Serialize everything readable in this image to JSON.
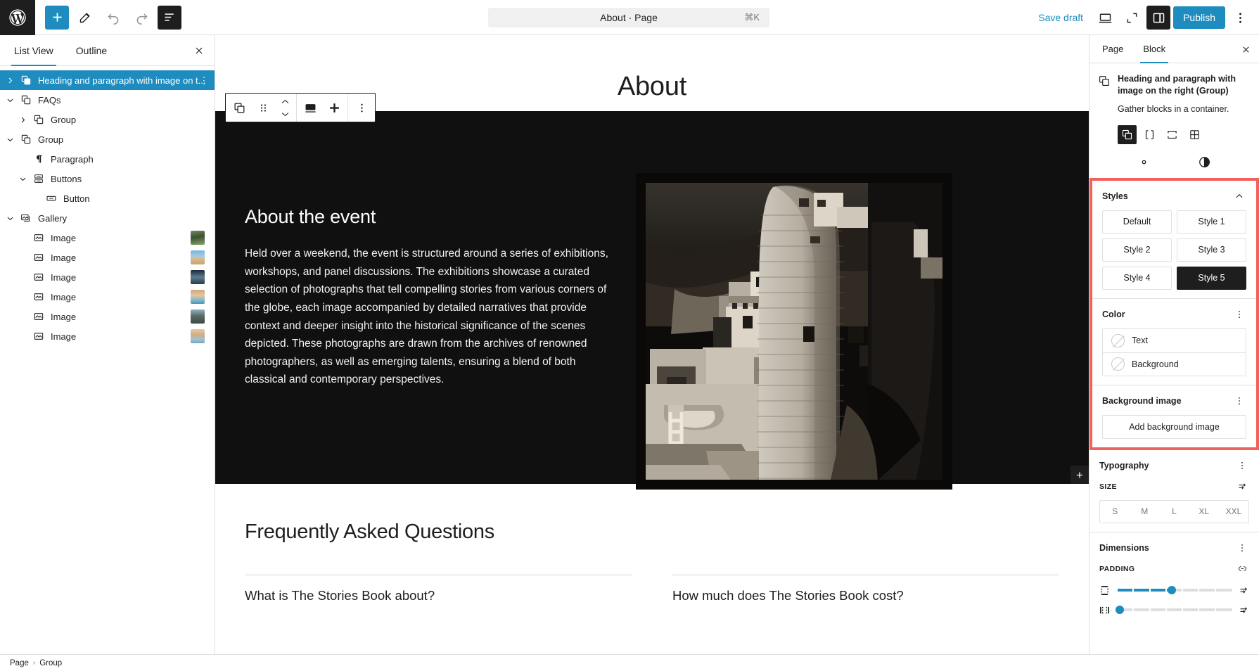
{
  "topbar": {
    "logo_icon": "wordpress-logo",
    "tools": [
      {
        "name": "add-block-button",
        "icon": "plus-icon"
      },
      {
        "name": "edit-tool-button",
        "icon": "pencil-icon"
      },
      {
        "name": "undo-button",
        "icon": "undo-arrow-icon"
      },
      {
        "name": "redo-button",
        "icon": "redo-arrow-icon"
      },
      {
        "name": "list-view-button",
        "icon": "list-view-icon"
      }
    ],
    "document_title": "About · Page",
    "command_shortcut": "⌘K",
    "save_draft_label": "Save draft",
    "preview_icon": "desktop-icon",
    "zoom_out_icon": "zoom-out-icon",
    "settings_panel_icon": "sidebar-toggle-icon",
    "publish_label": "Publish",
    "more_options_icon": "vertical-dots-icon",
    "accent_color": "#1e8cbe",
    "dark_color": "#1e1e1e"
  },
  "left_sidebar": {
    "tabs": [
      {
        "label": "List View",
        "active": true
      },
      {
        "label": "Outline",
        "active": false
      }
    ],
    "close_icon": "close-icon",
    "items": [
      {
        "label": "Heading and paragraph with image on t...",
        "icon": "group-block-icon",
        "indent": 0,
        "chevron": "right",
        "selected": true,
        "has_more": true,
        "thumb": ""
      },
      {
        "label": "FAQs",
        "icon": "group-block-icon",
        "indent": 0,
        "chevron": "down",
        "selected": false,
        "has_more": false,
        "thumb": ""
      },
      {
        "label": "Group",
        "icon": "group-block-icon",
        "indent": 1,
        "chevron": "right",
        "selected": false,
        "has_more": false,
        "thumb": ""
      },
      {
        "label": "Group",
        "icon": "group-block-icon",
        "indent": 0,
        "chevron": "down",
        "selected": false,
        "has_more": false,
        "thumb": ""
      },
      {
        "label": "Paragraph",
        "icon": "paragraph-icon",
        "indent": 1,
        "chevron": "none",
        "selected": false,
        "has_more": false,
        "thumb": ""
      },
      {
        "label": "Buttons",
        "icon": "buttons-icon",
        "indent": 1,
        "chevron": "down",
        "selected": false,
        "has_more": false,
        "thumb": ""
      },
      {
        "label": "Button",
        "icon": "button-icon",
        "indent": 2,
        "chevron": "none",
        "selected": false,
        "has_more": false,
        "thumb": ""
      },
      {
        "label": "Gallery",
        "icon": "gallery-icon",
        "indent": 0,
        "chevron": "down",
        "selected": false,
        "has_more": false,
        "thumb": ""
      },
      {
        "label": "Image",
        "icon": "image-icon",
        "indent": 1,
        "chevron": "none",
        "selected": false,
        "has_more": false,
        "thumb": "forest"
      },
      {
        "label": "Image",
        "icon": "image-icon",
        "indent": 1,
        "chevron": "none",
        "selected": false,
        "has_more": false,
        "thumb": "desert"
      },
      {
        "label": "Image",
        "icon": "image-icon",
        "indent": 1,
        "chevron": "none",
        "selected": false,
        "has_more": false,
        "thumb": "lake"
      },
      {
        "label": "Image",
        "icon": "image-icon",
        "indent": 1,
        "chevron": "none",
        "selected": false,
        "has_more": false,
        "thumb": "beach"
      },
      {
        "label": "Image",
        "icon": "image-icon",
        "indent": 1,
        "chevron": "none",
        "selected": false,
        "has_more": false,
        "thumb": "coast"
      },
      {
        "label": "Image",
        "icon": "image-icon",
        "indent": 1,
        "chevron": "none",
        "selected": false,
        "has_more": false,
        "thumb": "shore"
      }
    ]
  },
  "canvas": {
    "page_title": "About",
    "block_toolbar": {
      "block_type_icon": "group-block-icon",
      "drag_icon": "drag-handle-icon",
      "move_up_icon": "chevron-up-icon",
      "move_down_icon": "chevron-down-icon",
      "align_icon": "align-full-icon",
      "spacing_icon": "spacing-icon",
      "more_icon": "vertical-dots-icon"
    },
    "hero": {
      "heading": "About the event",
      "paragraph": "Held over a weekend, the event is structured around a series of exhibitions, workshops, and panel discussions. The exhibitions showcase a curated selection of photographs that tell compelling stories from various corners of the globe, each image accompanied by detailed narratives that provide context and deeper insight into the historical significance of the scenes depicted. These photographs are drawn from the archives of renowned photographers, as well as emerging talents, ensuring a blend of both classical and contemporary perspectives.",
      "background_color": "#101010",
      "text_color": "#ffffff",
      "appender_icon": "plus-icon",
      "image_alt": "Black and white photograph of ancient cliff dwelling ruins with a tall stone tower"
    },
    "faq": {
      "heading": "Frequently Asked Questions",
      "questions": [
        "What is The Stories Book about?",
        "How much does The Stories Book cost?"
      ]
    }
  },
  "right_sidebar": {
    "tabs": [
      {
        "label": "Page",
        "active": false
      },
      {
        "label": "Block",
        "active": true
      }
    ],
    "close_icon": "close-icon",
    "block_card": {
      "icon": "group-block-icon",
      "title": "Heading and paragraph with image on the right (Group)",
      "description": "Gather blocks in a container."
    },
    "variations": [
      {
        "name": "group-variation",
        "icon": "group-icon",
        "active": true
      },
      {
        "name": "row-variation",
        "icon": "row-icon",
        "active": false
      },
      {
        "name": "stack-variation",
        "icon": "stack-icon",
        "active": false
      },
      {
        "name": "grid-variation",
        "icon": "grid-icon",
        "active": false
      }
    ],
    "tab_icons": [
      {
        "name": "settings-tab",
        "icon": "gear-icon"
      },
      {
        "name": "styles-tab",
        "icon": "contrast-icon"
      }
    ],
    "styles_panel": {
      "title": "Styles",
      "collapse_icon": "chevron-up-icon",
      "options": [
        {
          "label": "Default",
          "active": false
        },
        {
          "label": "Style 1",
          "active": false
        },
        {
          "label": "Style 2",
          "active": false
        },
        {
          "label": "Style 3",
          "active": false
        },
        {
          "label": "Style 4",
          "active": false
        },
        {
          "label": "Style 5",
          "active": true
        }
      ]
    },
    "color_panel": {
      "title": "Color",
      "menu_icon": "vertical-dots-icon",
      "rows": [
        {
          "label": "Text",
          "swatch": "none"
        },
        {
          "label": "Background",
          "swatch": "none"
        }
      ]
    },
    "background_image_panel": {
      "title": "Background image",
      "menu_icon": "vertical-dots-icon",
      "button_label": "Add background image"
    },
    "typography_panel": {
      "title": "Typography",
      "menu_icon": "vertical-dots-icon",
      "size_label": "SIZE",
      "size_settings_icon": "sliders-icon",
      "sizes": [
        "S",
        "M",
        "L",
        "XL",
        "XXL"
      ]
    },
    "dimensions_panel": {
      "title": "Dimensions",
      "menu_icon": "vertical-dots-icon",
      "padding_label": "PADDING",
      "link_icon": "link-sides-icon",
      "sliders": [
        {
          "name": "vertical-padding-slider",
          "icon": "padding-vertical-icon",
          "value_pct": 48,
          "end_icon": "sliders-icon"
        },
        {
          "name": "horizontal-padding-slider",
          "icon": "padding-horizontal-icon",
          "value_pct": 3,
          "end_icon": "sliders-icon"
        }
      ]
    },
    "highlight_color": "#f2615e"
  },
  "bottom_bar": {
    "breadcrumbs": [
      "Page",
      "Group"
    ],
    "separator": "›"
  }
}
